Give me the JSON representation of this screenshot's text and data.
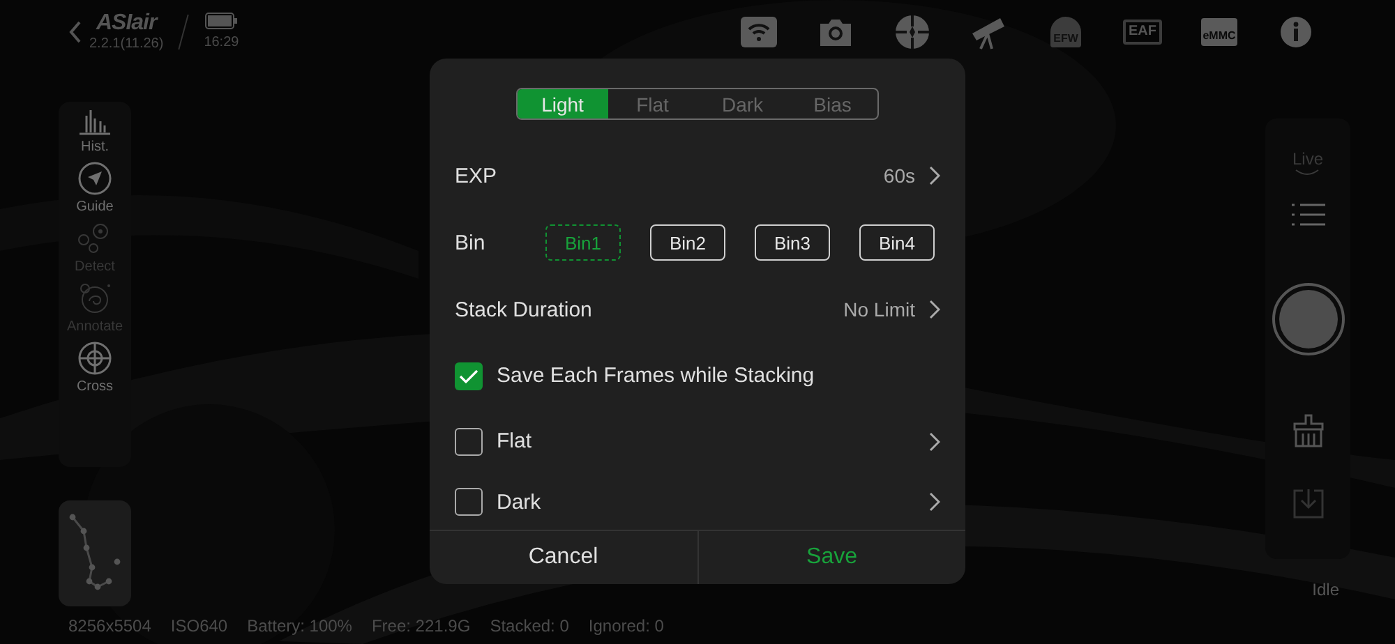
{
  "header": {
    "logo": "ASIair",
    "version": "2.2.1(11.26)",
    "time": "16:29"
  },
  "device_icons": [
    {
      "kind": "wifi",
      "enabled": true
    },
    {
      "kind": "camera",
      "enabled": true
    },
    {
      "kind": "guider",
      "enabled": true
    },
    {
      "kind": "telescope",
      "enabled": true
    },
    {
      "kind": "wheel",
      "label": "EFW",
      "enabled": false
    },
    {
      "kind": "focuser",
      "label": "EAF",
      "enabled": false
    },
    {
      "kind": "storage",
      "label": "eMMC",
      "enabled": true
    },
    {
      "kind": "info",
      "enabled": true
    }
  ],
  "tools": [
    {
      "kind": "hist",
      "label": "Hist.",
      "disabled": false
    },
    {
      "kind": "guide",
      "label": "Guide",
      "disabled": false
    },
    {
      "kind": "detect",
      "label": "Detect",
      "disabled": true
    },
    {
      "kind": "annotate",
      "label": "Annotate",
      "disabled": true
    },
    {
      "kind": "cross",
      "label": "Cross",
      "disabled": false
    }
  ],
  "right_panel": {
    "mode": "Live",
    "state": "Idle"
  },
  "dialog": {
    "tabs": [
      {
        "label": "Light",
        "selected": true
      },
      {
        "label": "Flat",
        "selected": false
      },
      {
        "label": "Dark",
        "selected": false
      },
      {
        "label": "Bias",
        "selected": false
      }
    ],
    "exp": {
      "label": "EXP",
      "value": "60s"
    },
    "bin": {
      "label": "Bin",
      "options": [
        {
          "label": "Bin1",
          "selected": true
        },
        {
          "label": "Bin2",
          "selected": false
        },
        {
          "label": "Bin3",
          "selected": false
        },
        {
          "label": "Bin4",
          "selected": false
        }
      ]
    },
    "stack_duration": {
      "label": "Stack Duration",
      "value": "No Limit"
    },
    "checks": [
      {
        "label": "Save Each Frames while Stacking",
        "checked": true,
        "arrow": false
      },
      {
        "label": "Flat",
        "checked": false,
        "arrow": true
      },
      {
        "label": "Dark",
        "checked": false,
        "arrow": true
      }
    ],
    "buttons": [
      {
        "label": "Cancel",
        "kind": "cancel"
      },
      {
        "label": "Save",
        "kind": "save"
      }
    ]
  },
  "status_bar": [
    "8256x5504",
    "ISO640",
    "Battery: 100%",
    "Free: 221.9G",
    "Stacked: 0",
    "Ignored: 0"
  ]
}
